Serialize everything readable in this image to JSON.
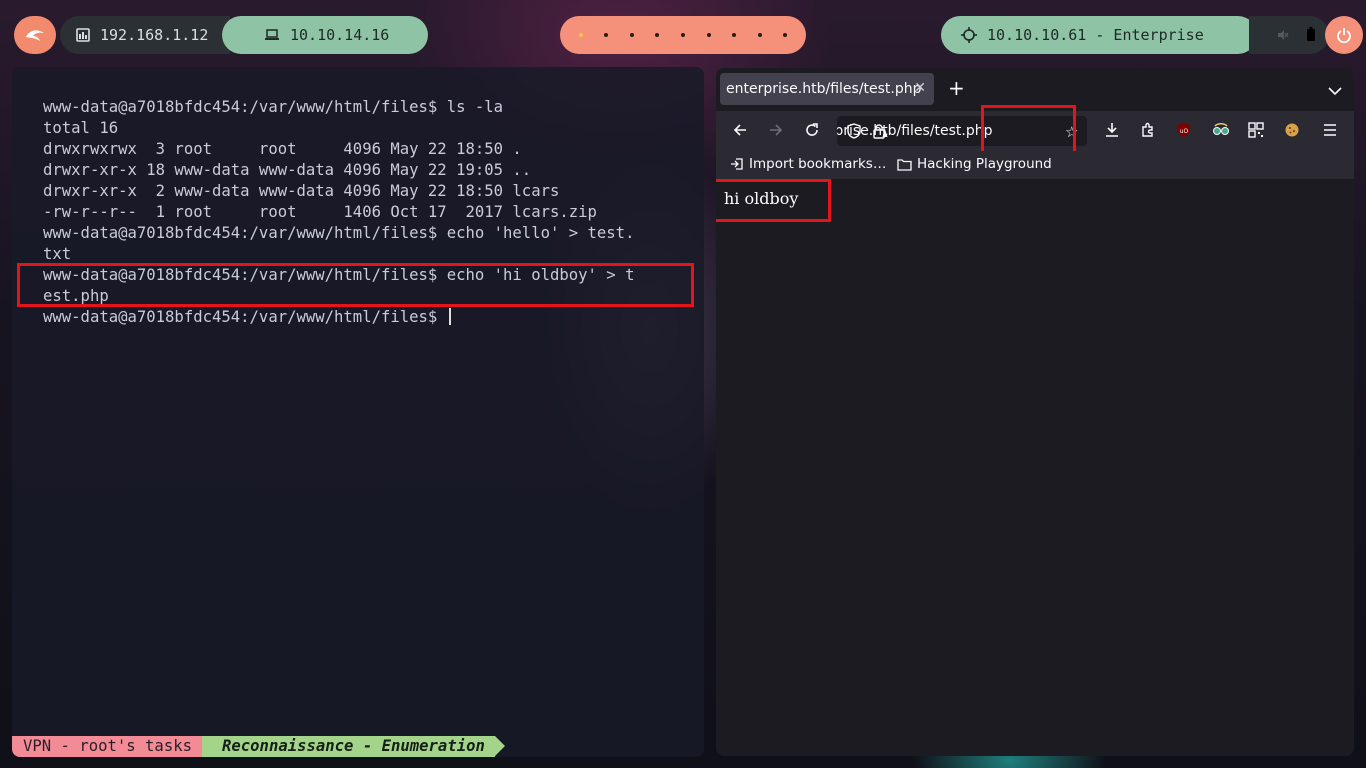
{
  "topbar": {
    "lan_ip": "192.168.1.12",
    "vpn_ip": "10.10.14.16",
    "target": "10.10.10.61 - Enterprise",
    "workspaces": 9,
    "active_workspace": 0
  },
  "terminal": {
    "lines": [
      "www-data@a7018bfdc454:/var/www/html/files$ ls -la",
      "total 16",
      "drwxrwxrwx  3 root     root     4096 May 22 18:50 .",
      "drwxr-xr-x 18 www-data www-data 4096 May 22 19:05 ..",
      "drwxr-xr-x  2 www-data www-data 4096 May 22 18:50 lcars",
      "-rw-r--r--  1 root     root     1406 Oct 17  2017 lcars.zip",
      "www-data@a7018bfdc454:/var/www/html/files$ echo 'hello' > test.",
      "txt",
      "www-data@a7018bfdc454:/var/www/html/files$ echo 'hi oldboy' > t",
      "est.php"
    ],
    "prompt": "www-data@a7018bfdc454:/var/www/html/files$ ",
    "status": {
      "left": "VPN - root's tasks",
      "right": "Reconnaissance - Enumeration"
    }
  },
  "browser": {
    "tab_title": "enterprise.htb/files/test.php",
    "url": "enterprise.htb/files/test.php",
    "bookmarks": [
      "Import bookmarks…",
      "Hacking Playground"
    ],
    "page_text": "hi oldboy"
  },
  "colors": {
    "accent_salmon": "#f5907a",
    "accent_green": "#8fc3a5",
    "highlight_red": "#e3151b"
  }
}
